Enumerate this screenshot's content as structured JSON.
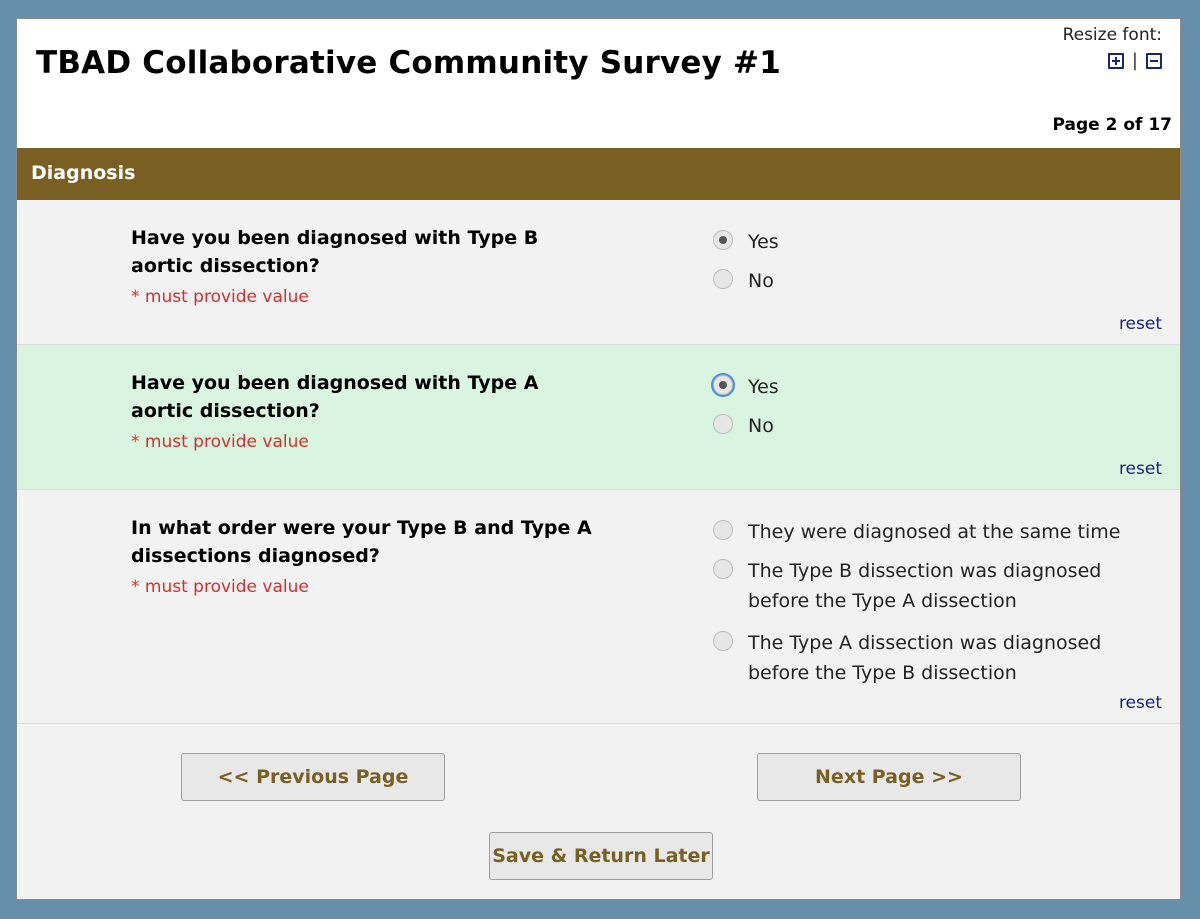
{
  "header": {
    "title": "TBAD Collaborative Community Survey #1",
    "resize_label": "Resize font:",
    "separator": "|",
    "page_indicator": "Page 2 of 17"
  },
  "section": {
    "title": "Diagnosis"
  },
  "questions": [
    {
      "label": "Have you been diagnosed with Type B aortic dissection?",
      "required": "* must provide value",
      "options": [
        "Yes",
        "No"
      ],
      "selected": "Yes",
      "reset": "reset"
    },
    {
      "label": "Have you been diagnosed with Type A aortic dissection?",
      "required": "* must provide value",
      "options": [
        "Yes",
        "No"
      ],
      "selected": "Yes",
      "reset": "reset"
    },
    {
      "label": "In what order were your Type B and Type A dissections diagnosed?",
      "required": "* must provide value",
      "options": [
        "They were diagnosed at the same time",
        "The Type B dissection was diagnosed before the Type A dissection",
        "The Type A dissection was diagnosed before the Type B dissection"
      ],
      "selected": "",
      "reset": "reset"
    }
  ],
  "buttons": {
    "previous": "<< Previous Page",
    "next": "Next Page >>",
    "save": "Save & Return Later"
  },
  "colors": {
    "background": "#6690aa",
    "section_bar": "#7a5f23",
    "highlight_row": "#d9f5e0",
    "required_text": "#d32f2f",
    "button_text": "#7a5f23"
  },
  "icons": {
    "increase_font": "plus-square-icon",
    "decrease_font": "minus-square-icon"
  }
}
